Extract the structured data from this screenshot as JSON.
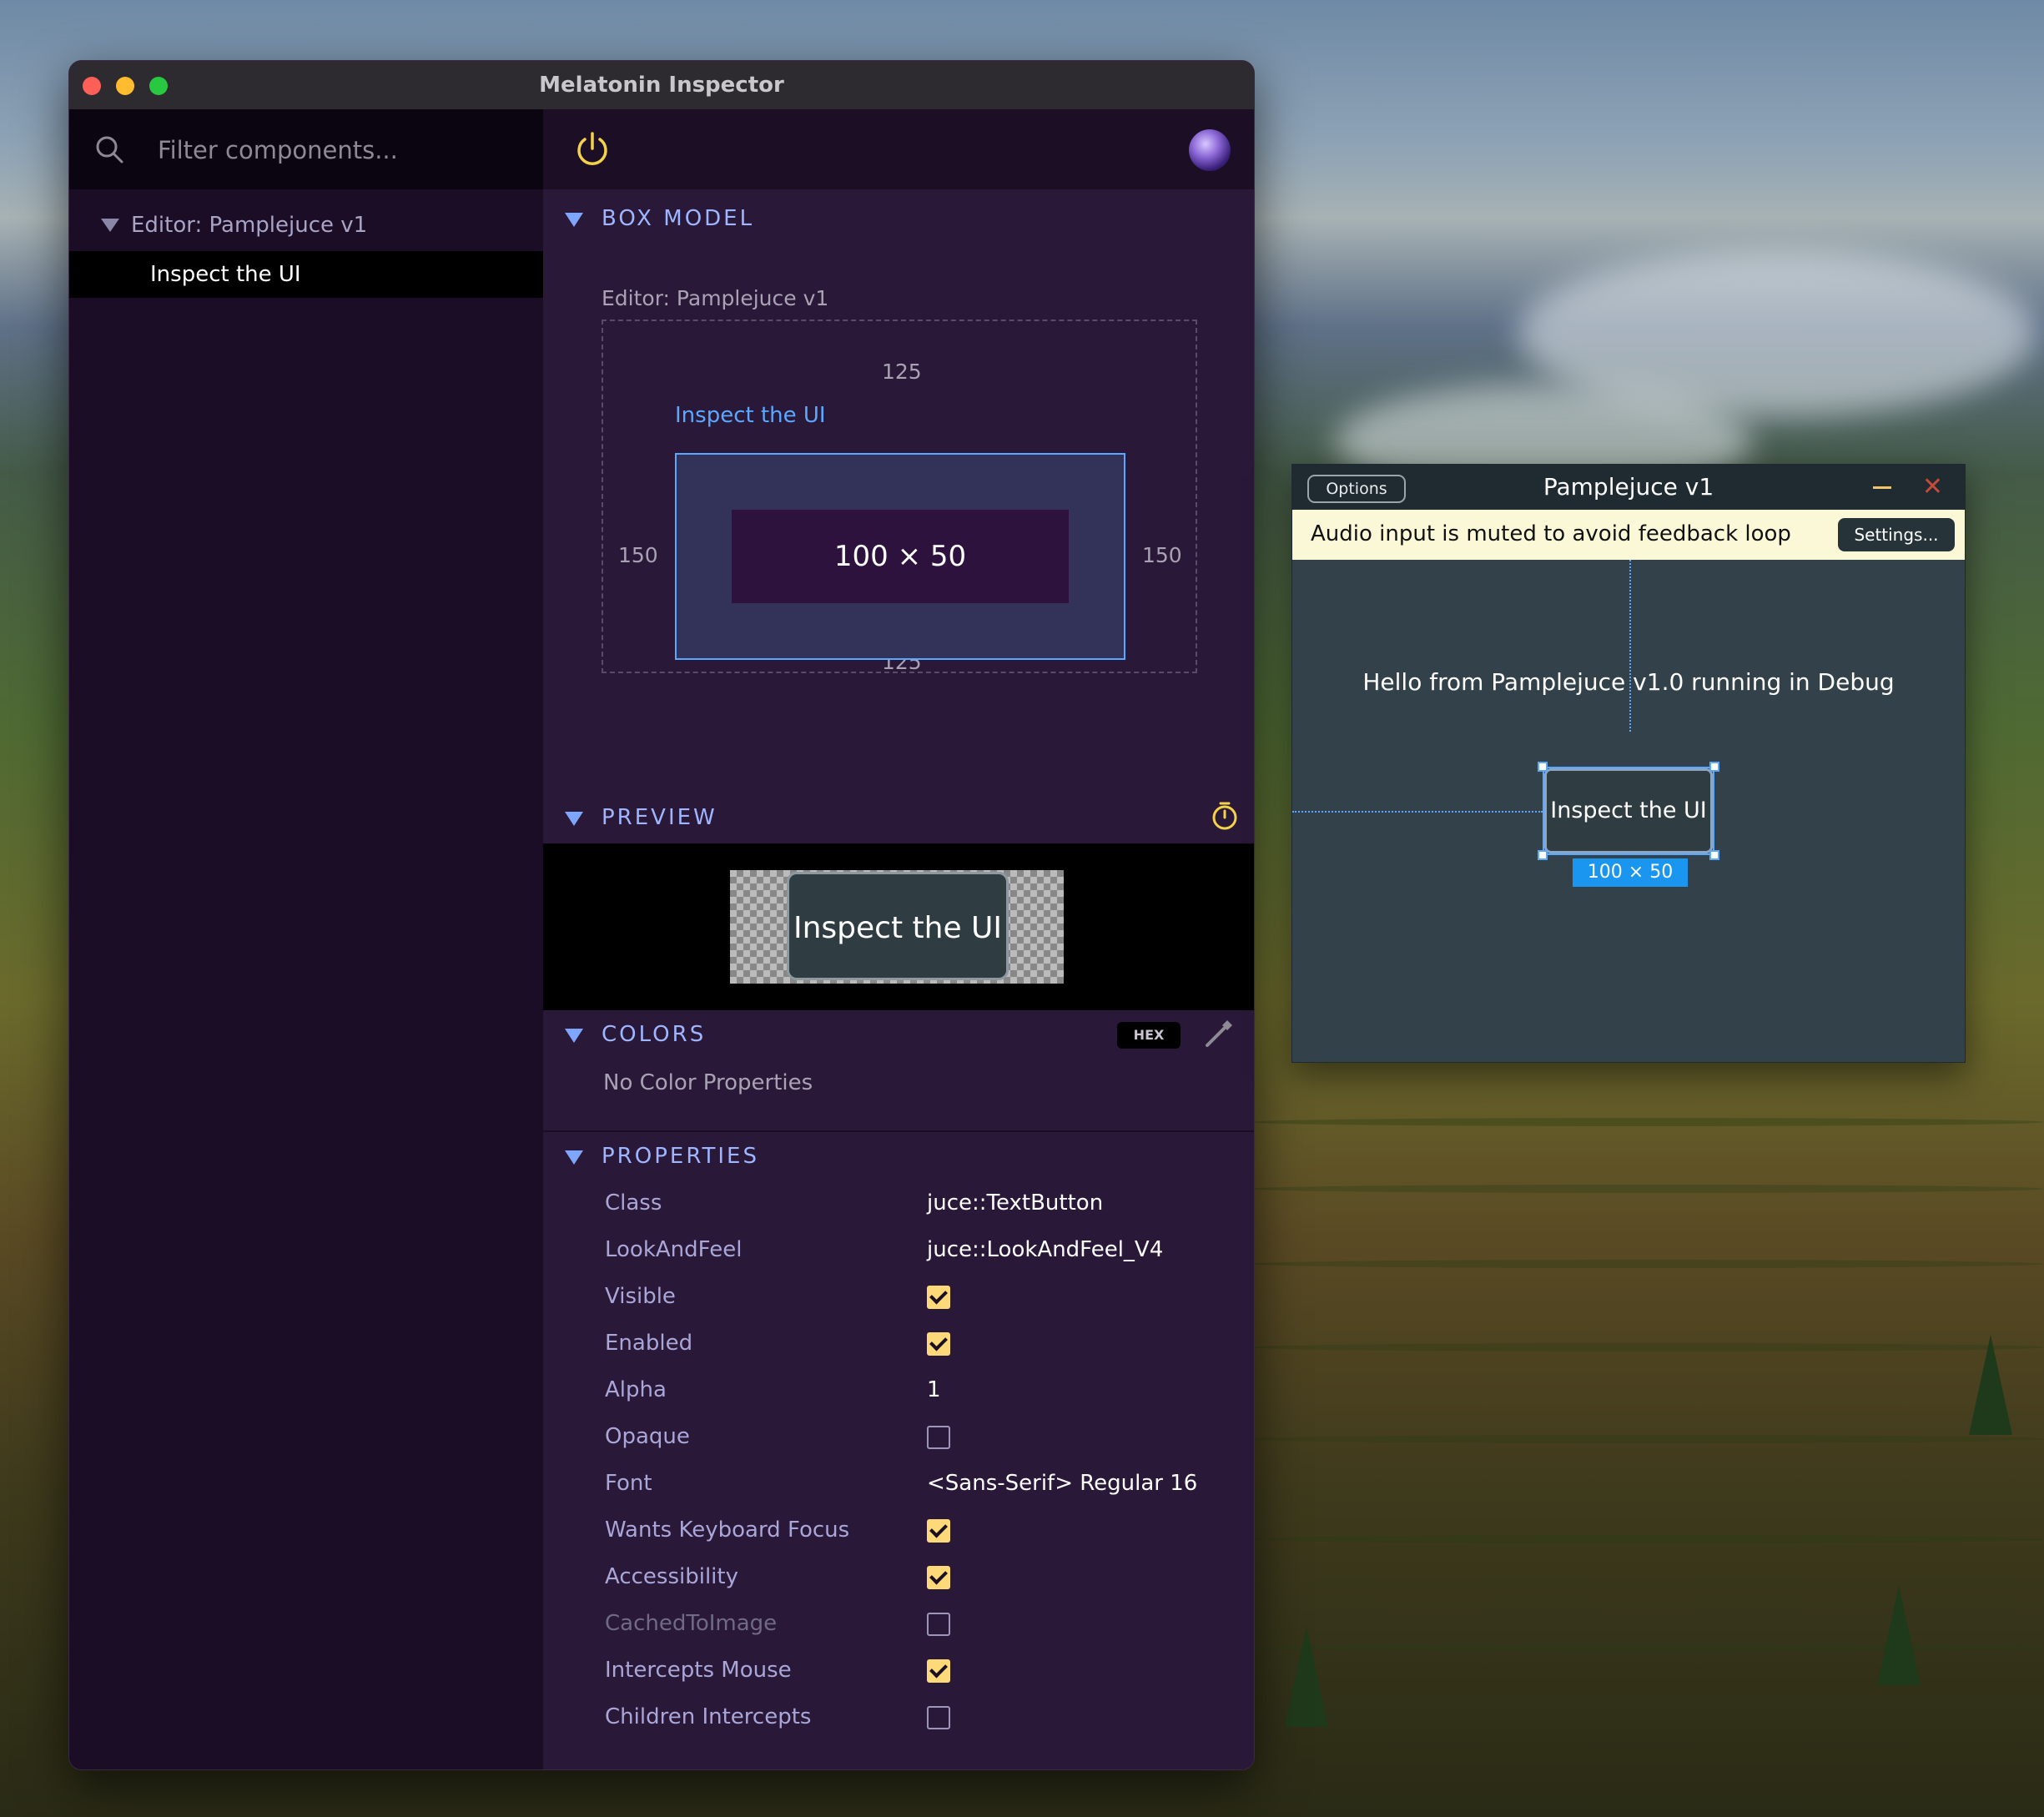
{
  "inspector": {
    "window_title": "Melatonin Inspector",
    "search": {
      "placeholder": "Filter components..."
    },
    "tree": {
      "parent": "Editor: Pamplejuce v1",
      "selected_child": "Inspect the UI"
    },
    "box_model": {
      "header": "BOX MODEL",
      "owner": "Editor: Pamplejuce v1",
      "component_name": "Inspect the UI",
      "top": "125",
      "bottom": "125",
      "left": "150",
      "right": "150",
      "size": "100 × 50"
    },
    "preview": {
      "header": "PREVIEW",
      "button_label": "Inspect the UI"
    },
    "colors": {
      "header": "COLORS",
      "hex_label": "HEX",
      "empty_text": "No Color Properties"
    },
    "properties": {
      "header": "PROPERTIES",
      "rows": [
        {
          "key": "Class",
          "value": "juce::TextButton"
        },
        {
          "key": "LookAndFeel",
          "value": "juce::LookAndFeel_V4"
        },
        {
          "key": "Visible",
          "checked": true
        },
        {
          "key": "Enabled",
          "checked": true
        },
        {
          "key": "Alpha",
          "value": "1"
        },
        {
          "key": "Opaque",
          "checked": false
        },
        {
          "key": "Font",
          "value": "<Sans-Serif> Regular 16"
        },
        {
          "key": "Wants Keyboard Focus",
          "checked": true
        },
        {
          "key": "Accessibility",
          "checked": true
        },
        {
          "key": "CachedToImage",
          "checked": false,
          "dimmed": true
        },
        {
          "key": "Intercepts Mouse",
          "checked": true
        },
        {
          "key": "Children Intercepts",
          "checked": false
        }
      ]
    },
    "colors_theme": {
      "accent_blue": "#5aa8ff",
      "checkbox_on": "#fdd97a",
      "panel_bg": "#2a1838",
      "sidebar_bg": "#1c0d27"
    }
  },
  "plugin": {
    "window_title": "Pamplejuce v1",
    "options_label": "Options",
    "notice": "Audio input is muted to avoid feedback loop",
    "settings_label": "Settings...",
    "hello": "Hello from Pamplejuce v1.0 running in Debug",
    "button_label": "Inspect the UI",
    "size_badge": "100 × 50"
  },
  "icons": [
    "search-icon",
    "power-icon",
    "avatar",
    "stopwatch-icon",
    "eyedropper-icon",
    "disclosure-triangle-icon",
    "close-icon",
    "minimize-icon"
  ]
}
